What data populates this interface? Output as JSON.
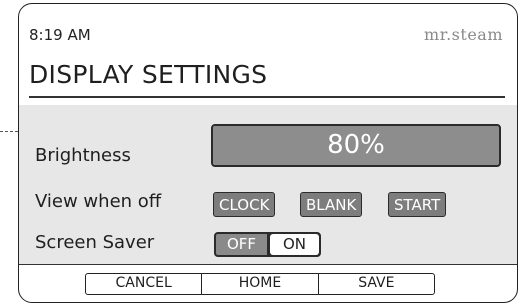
{
  "status_bar": {
    "time": "8:19 AM",
    "brand": "mr.steam"
  },
  "title": "DISPLAY SETTINGS",
  "brightness": {
    "label": "Brightness",
    "value_text": "80%",
    "level_fraction": 0.8
  },
  "view_when_off": {
    "label": "View when off",
    "options": [
      "CLOCK",
      "BLANK",
      "START"
    ]
  },
  "screen_saver": {
    "label": "Screen Saver",
    "off_label": "OFF",
    "on_label": "ON"
  },
  "softkeys": {
    "cancel": "CANCEL",
    "home": "HOME",
    "save": "SAVE"
  },
  "colors": {
    "panel_bg": "#e7e7e7",
    "control_fill": "#8d8d8d",
    "border": "#2b2b2b",
    "brand_gray": "#8a8a8a"
  }
}
